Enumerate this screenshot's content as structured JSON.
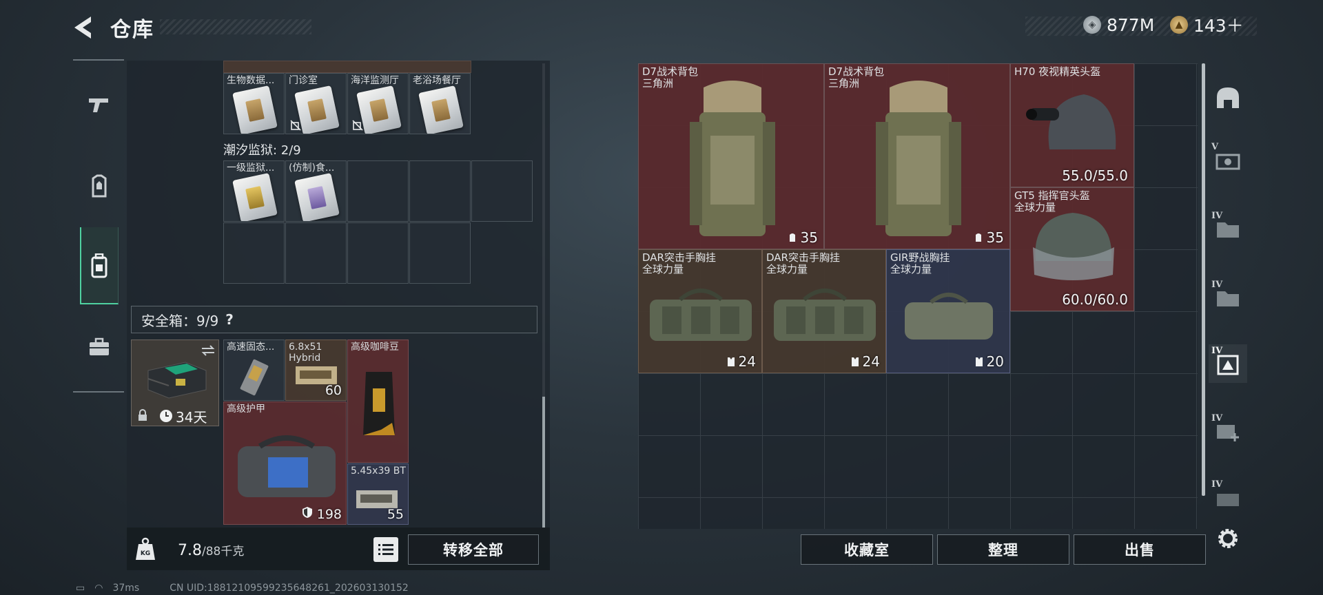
{
  "header": {
    "title": "仓库",
    "currency_silver": "877M",
    "currency_gold": "143＋"
  },
  "left_rail": [
    "pistol-icon",
    "chest-rig-icon",
    "backpack-icon",
    "safe-case-icon"
  ],
  "containers": {
    "row1": [
      {
        "label": "生物数据...",
        "card": "silver"
      },
      {
        "label": "门诊室",
        "card": "silver"
      },
      {
        "label": "海洋监测厅",
        "card": "silver"
      },
      {
        "label": "老浴场餐厅",
        "card": "silver"
      }
    ],
    "prison_title": "潮汐监狱: 2/9",
    "row2": [
      {
        "label": "一级监狱...",
        "card": "gold"
      },
      {
        "label": "(仿制)食...",
        "card": "violet"
      }
    ]
  },
  "safe": {
    "label": "安全箱：9/9",
    "help": "?",
    "days": "34天",
    "items": [
      {
        "label": "高速固态...",
        "count": ""
      },
      {
        "label": "6.8x51 Hybrid",
        "count": "60"
      },
      {
        "label": "高级咖啡豆",
        "count": ""
      },
      {
        "label": "高级护甲",
        "count": "198"
      },
      {
        "label": "5.45x39 BT",
        "count": "55"
      }
    ]
  },
  "weight": {
    "value": "7.8",
    "unit": "/88千克"
  },
  "buttons": {
    "transfer_all": "转移全部",
    "collection": "收藏室",
    "sort": "整理",
    "sell": "出售"
  },
  "stash": [
    {
      "name": "D7战术背包",
      "sub": "三角洲",
      "count": "35",
      "rarity": "red"
    },
    {
      "name": "D7战术背包",
      "sub": "三角洲",
      "count": "35",
      "rarity": "red"
    },
    {
      "name": "H70 夜视精英头盔",
      "sub": "",
      "count": "55.0/55.0",
      "rarity": "red"
    },
    {
      "name": "GT5 指挥官头盔",
      "sub": "全球力量",
      "count": "60.0/60.0",
      "rarity": "red"
    },
    {
      "name": "DAR突击手胸挂",
      "sub": "全球力量",
      "count": "24",
      "rarity": "brown"
    },
    {
      "name": "DAR突击手胸挂",
      "sub": "全球力量",
      "count": "24",
      "rarity": "brown"
    },
    {
      "name": "GIR野战胸挂",
      "sub": "全球力量",
      "count": "20",
      "rarity": "navy"
    }
  ],
  "right_rail": [
    {
      "icon": "helmet-filter-icon",
      "tier": ""
    },
    {
      "icon": "tier5-container-icon",
      "tier": "V"
    },
    {
      "icon": "tier4-folder-icon",
      "tier": "IV"
    },
    {
      "icon": "tier4-folder-icon",
      "tier": "IV"
    },
    {
      "icon": "tier4-selected-icon",
      "tier": "IV"
    },
    {
      "icon": "tier4-add-icon",
      "tier": "IV"
    },
    {
      "icon": "tier4-box-icon",
      "tier": "IV"
    },
    {
      "icon": "settings-gear-icon",
      "tier": ""
    }
  ],
  "status": {
    "ping": "37ms",
    "uid": "CN UID:18812109599235648261_202603130152"
  }
}
